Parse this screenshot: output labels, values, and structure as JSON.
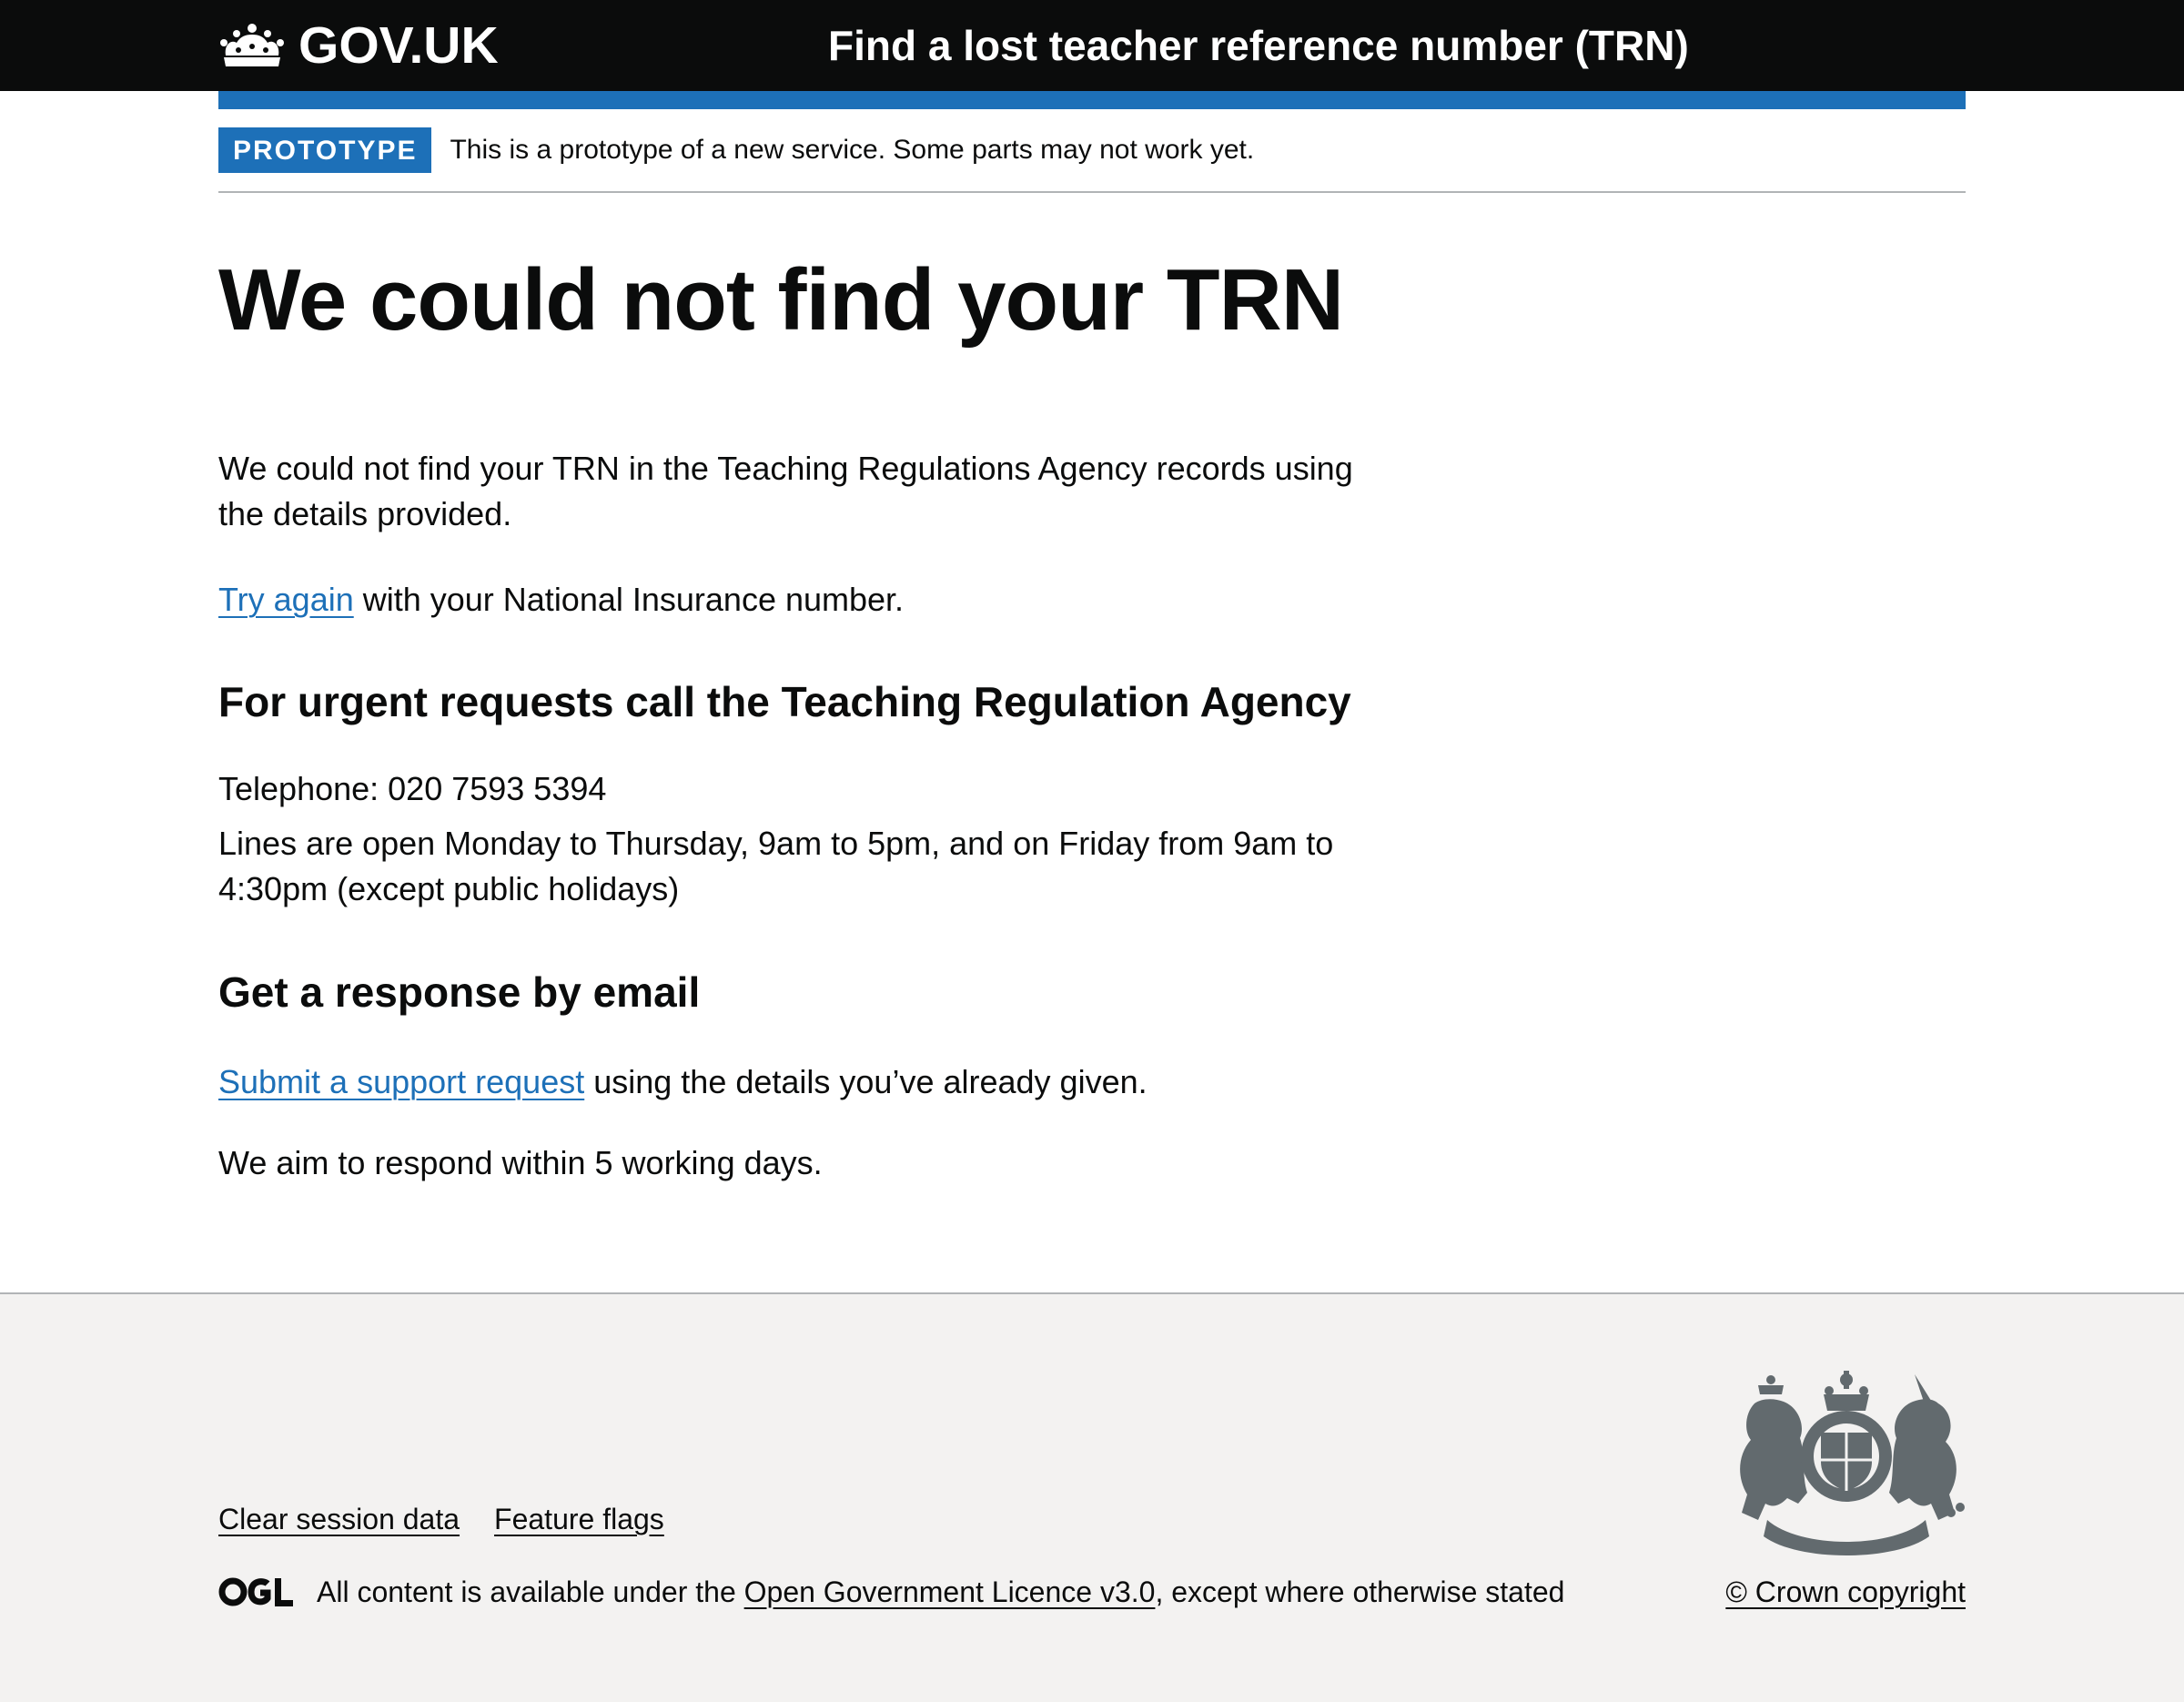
{
  "header": {
    "logo_text": "GOV.UK",
    "service_name": "Find a lost teacher reference number (TRN)"
  },
  "phase_banner": {
    "tag": "PROTOTYPE",
    "text": "This is a prototype of a new service. Some parts may not work yet."
  },
  "main": {
    "title": "We could not find your TRN",
    "intro": "We could not find your TRN in the Teaching Regulations Agency records using the details provided.",
    "try_again_link": "Try again",
    "try_again_suffix": " with your National Insurance number.",
    "urgent_heading": "For urgent requests call the Teaching Regulation Agency",
    "telephone": "Telephone: 020 7593 5394",
    "opening_hours": "Lines are open Monday to Thursday, 9am to 5pm, and on Friday from 9am to 4:30pm (except public holidays)",
    "email_heading": "Get a response by email",
    "support_link": "Submit a support request",
    "support_suffix": " using the details you’ve already given.",
    "response_time": "We aim to respond within 5 working days."
  },
  "footer": {
    "links": [
      "Clear session data",
      "Feature flags"
    ],
    "licence_prefix": "All content is available under the ",
    "licence_link": "Open Government Licence v3.0",
    "licence_suffix": ", except where otherwise stated",
    "copyright": "© Crown copyright"
  },
  "colors": {
    "header_bg": "#0b0c0c",
    "brand_blue": "#1d70b8",
    "footer_bg": "#f3f2f1",
    "text": "#0b0c0c",
    "crest_grey": "#626a6e"
  }
}
